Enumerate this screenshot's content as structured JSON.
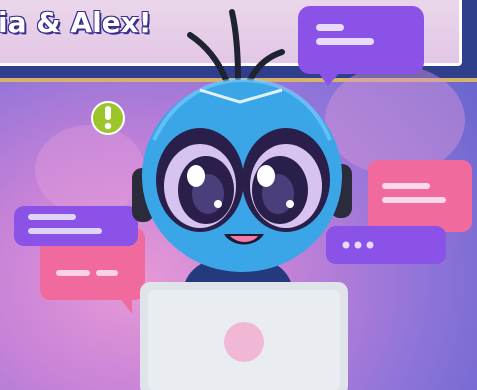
{
  "banner": {
    "title": "ia & Alex!"
  },
  "colors": {
    "background": "#c782d8",
    "banner": "#2f3f8c",
    "robot_head": "#3aa6e8",
    "robot_eye": "#2a1f4a",
    "bubble_purple": "#8a52e6",
    "bubble_pink": "#f06a9e",
    "laptop": "#dfe3ea",
    "alert": "#9cc52b"
  },
  "icons": [
    "alert-icon",
    "chat-bubble-icon",
    "laptop-icon",
    "robot-mascot"
  ]
}
